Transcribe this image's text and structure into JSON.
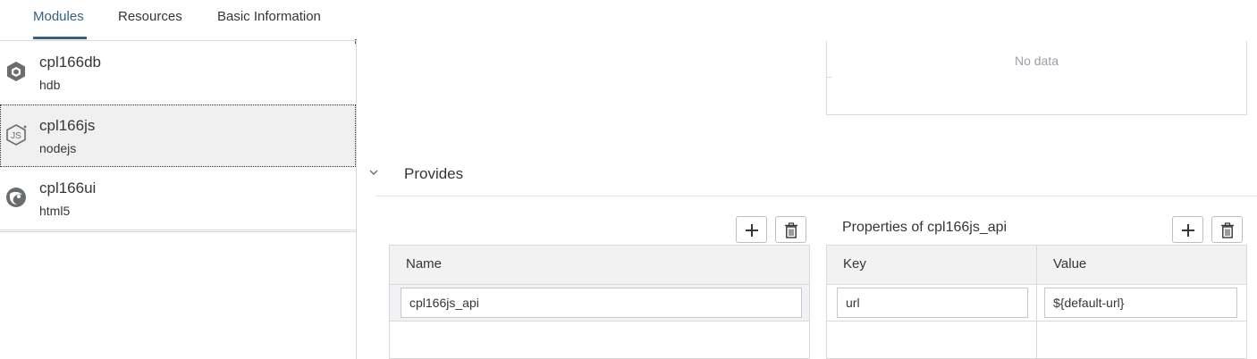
{
  "tabs": [
    {
      "label": "Modules"
    },
    {
      "label": "Resources"
    },
    {
      "label": "Basic Information"
    }
  ],
  "modules": [
    {
      "name": "cpl166db",
      "type": "hdb",
      "icon": "hdb-cube-icon"
    },
    {
      "name": "cpl166js",
      "type": "nodejs",
      "icon": "nodejs-icon"
    },
    {
      "name": "cpl166ui",
      "type": "html5",
      "icon": "html5-icon"
    }
  ],
  "selected_module": "cpl166js",
  "requires_table": {
    "empty_text": "No data"
  },
  "provides": {
    "title": "Provides",
    "table": {
      "columns": [
        "Name"
      ],
      "rows": [
        {
          "name": "cpl166js_api"
        }
      ]
    },
    "properties": {
      "title": "Properties of cpl166js_api",
      "columns": [
        "Key",
        "Value"
      ],
      "rows": [
        {
          "key": "url",
          "value": "${default-url}"
        }
      ]
    }
  },
  "colors": {
    "accent": "#346187",
    "selected_row": "#f0f0f1"
  }
}
